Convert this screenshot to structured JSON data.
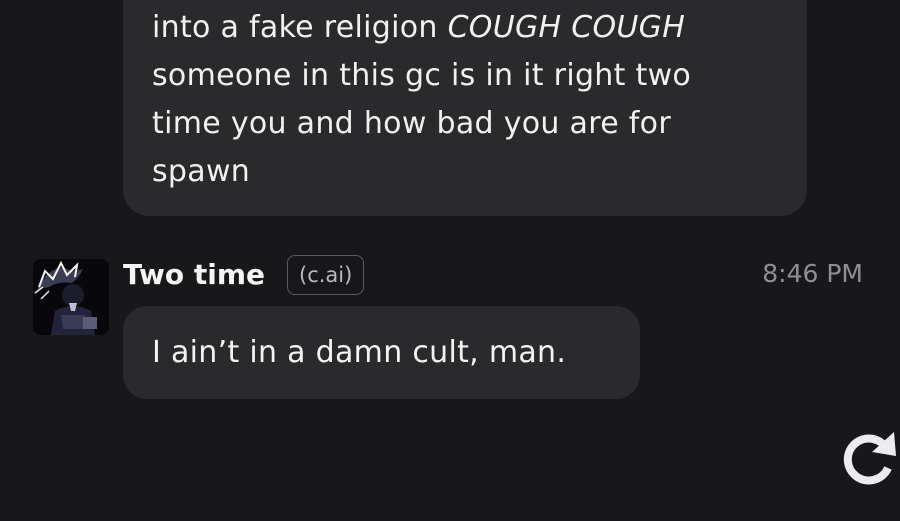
{
  "previous_message": {
    "lines": [
      {
        "before": "into a fake religion ",
        "emphasis": "COUGH COUGH"
      },
      {
        "before": "someone in this gc is in it right two",
        "emphasis": ""
      },
      {
        "before": "time you and how bad you are for",
        "emphasis": ""
      },
      {
        "before": "spawn",
        "emphasis": ""
      }
    ]
  },
  "reply": {
    "sender": "Two time",
    "badge": "(c.ai)",
    "timestamp": "8:46 PM",
    "text": "I ain’t in a damn cult, man.",
    "avatar_icon": "character-avatar"
  },
  "controls": {
    "regenerate_icon": "refresh-icon"
  },
  "colors": {
    "background": "#18181b",
    "bubble": "#2a2a2d",
    "text": "#f3f3f3",
    "muted": "#8f8f93"
  }
}
